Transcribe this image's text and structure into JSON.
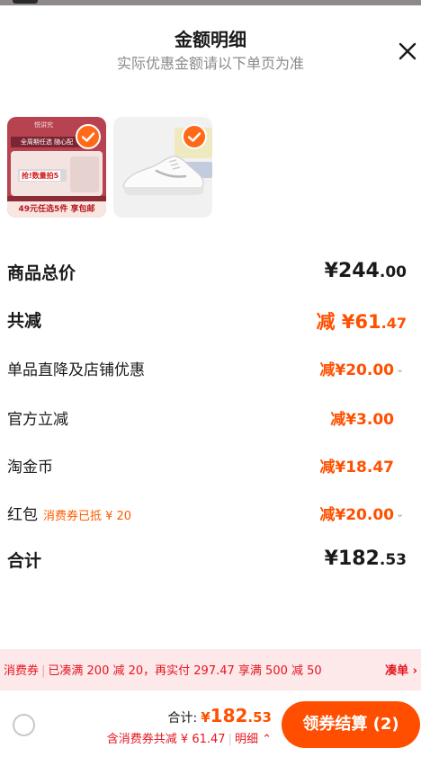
{
  "header": {
    "title": "金额明细",
    "subtitle": "实际优惠金额请以下单页为准"
  },
  "products": [
    {
      "name": "item-1",
      "image_text": {
        "brand": "悦讲究",
        "band": "全周期任选 随心配",
        "badge": "抢!数量拍5",
        "footer": "49元任选5件 享包邮"
      },
      "selected": true
    },
    {
      "name": "item-2",
      "selected": true
    }
  ],
  "breakdown": {
    "subtotal": {
      "label": "商品总价",
      "currency": "¥",
      "int": "244",
      "dec": ".00"
    },
    "total_discount": {
      "label": "共减",
      "prefix": "减",
      "currency": "¥",
      "int": "61",
      "dec": ".47"
    },
    "items": [
      {
        "label": "单品直降及店铺优惠",
        "value": "减¥20.00",
        "has_dropdown": true
      },
      {
        "label": "官方立减",
        "value": "减¥3.00",
        "has_dropdown": false
      },
      {
        "label": "淘金币",
        "value": "减¥18.47",
        "has_dropdown": false
      },
      {
        "label": "红包",
        "tag": "消费券已抵 ¥ 20",
        "value": "减¥20.00",
        "has_dropdown": true
      }
    ],
    "total": {
      "label": "合计",
      "currency": "¥",
      "int": "182",
      "dec": ".53"
    }
  },
  "banner": {
    "type": "消费券",
    "text": "已凑满 200 减 20，再实付 297.47 享满 500 减 50",
    "action": "凑单"
  },
  "footer": {
    "total_label": "合计:",
    "currency": "¥",
    "int": "182",
    "dec": ".53",
    "discount_note": "含消费券共减 ¥ 61.47",
    "detail_link": "明细",
    "checkout_label": "领券结算 (2)"
  },
  "colors": {
    "accent": "#ff5000",
    "banner_bg": "#fde8ea",
    "banner_text": "#e6161f"
  }
}
